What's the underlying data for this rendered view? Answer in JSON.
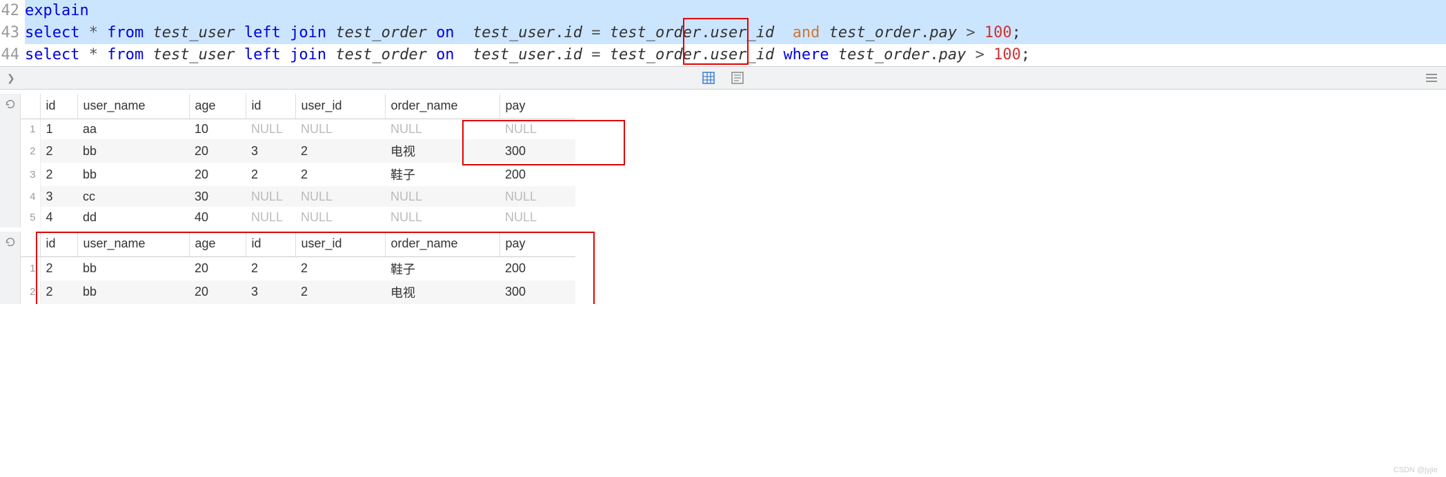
{
  "editor": {
    "lines": [
      {
        "num": "42",
        "selected": true,
        "tokens": [
          {
            "text": "explain",
            "cls": "kw-blue"
          }
        ]
      },
      {
        "num": "43",
        "selected": true,
        "tokens": [
          {
            "text": "select ",
            "cls": "kw-blue"
          },
          {
            "text": "* ",
            "cls": "op"
          },
          {
            "text": "from ",
            "cls": "kw-blue"
          },
          {
            "text": "test_user ",
            "cls": "ident"
          },
          {
            "text": "left join ",
            "cls": "kw-blue"
          },
          {
            "text": "test_order ",
            "cls": "ident"
          },
          {
            "text": "on  ",
            "cls": "kw-blue"
          },
          {
            "text": "test_user",
            "cls": "ident"
          },
          {
            "text": ".",
            "cls": "sym"
          },
          {
            "text": "id ",
            "cls": "ident"
          },
          {
            "text": "= ",
            "cls": "op"
          },
          {
            "text": "test_order",
            "cls": "ident"
          },
          {
            "text": ".",
            "cls": "sym"
          },
          {
            "text": "user_id  ",
            "cls": "ident"
          },
          {
            "text": "and ",
            "cls": "kw-orange"
          },
          {
            "text": "test_order",
            "cls": "ident"
          },
          {
            "text": ".",
            "cls": "sym"
          },
          {
            "text": "pay ",
            "cls": "ident"
          },
          {
            "text": "> ",
            "cls": "op"
          },
          {
            "text": "100",
            "cls": "num"
          },
          {
            "text": ";",
            "cls": "sym"
          }
        ]
      },
      {
        "num": "44",
        "selected": false,
        "tokens": [
          {
            "text": "select ",
            "cls": "kw-blue"
          },
          {
            "text": "* ",
            "cls": "op"
          },
          {
            "text": "from ",
            "cls": "kw-blue"
          },
          {
            "text": "test_user ",
            "cls": "ident"
          },
          {
            "text": "left join ",
            "cls": "kw-blue"
          },
          {
            "text": "test_order ",
            "cls": "ident"
          },
          {
            "text": "on  ",
            "cls": "kw-blue"
          },
          {
            "text": "test_user",
            "cls": "ident"
          },
          {
            "text": ".",
            "cls": "sym"
          },
          {
            "text": "id ",
            "cls": "ident"
          },
          {
            "text": "= ",
            "cls": "op"
          },
          {
            "text": "test_order",
            "cls": "ident"
          },
          {
            "text": ".",
            "cls": "sym"
          },
          {
            "text": "user_id ",
            "cls": "ident"
          },
          {
            "text": "where ",
            "cls": "kw-blue"
          },
          {
            "text": "test_order",
            "cls": "ident"
          },
          {
            "text": ".",
            "cls": "sym"
          },
          {
            "text": "pay ",
            "cls": "ident"
          },
          {
            "text": "> ",
            "cls": "op"
          },
          {
            "text": "100",
            "cls": "num"
          },
          {
            "text": ";",
            "cls": "sym"
          }
        ]
      }
    ]
  },
  "columns": [
    "id",
    "user_name",
    "age",
    "id",
    "user_id",
    "order_name",
    "pay"
  ],
  "null_text": "NULL",
  "result1": {
    "rows": [
      {
        "n": "1",
        "id": "1",
        "user_name": "aa",
        "age": "10",
        "id2": null,
        "user_id": null,
        "order_name": null,
        "pay": null
      },
      {
        "n": "2",
        "id": "2",
        "user_name": "bb",
        "age": "20",
        "id2": "3",
        "user_id": "2",
        "order_name": "电视",
        "pay": "300"
      },
      {
        "n": "3",
        "id": "2",
        "user_name": "bb",
        "age": "20",
        "id2": "2",
        "user_id": "2",
        "order_name": "鞋子",
        "pay": "200"
      },
      {
        "n": "4",
        "id": "3",
        "user_name": "cc",
        "age": "30",
        "id2": null,
        "user_id": null,
        "order_name": null,
        "pay": null
      },
      {
        "n": "5",
        "id": "4",
        "user_name": "dd",
        "age": "40",
        "id2": null,
        "user_id": null,
        "order_name": null,
        "pay": null
      }
    ]
  },
  "result2": {
    "rows": [
      {
        "n": "1",
        "id": "2",
        "user_name": "bb",
        "age": "20",
        "id2": "2",
        "user_id": "2",
        "order_name": "鞋子",
        "pay": "200"
      },
      {
        "n": "2",
        "id": "2",
        "user_name": "bb",
        "age": "20",
        "id2": "3",
        "user_id": "2",
        "order_name": "电视",
        "pay": "300"
      }
    ]
  },
  "watermark": "CSDN @jyjie"
}
